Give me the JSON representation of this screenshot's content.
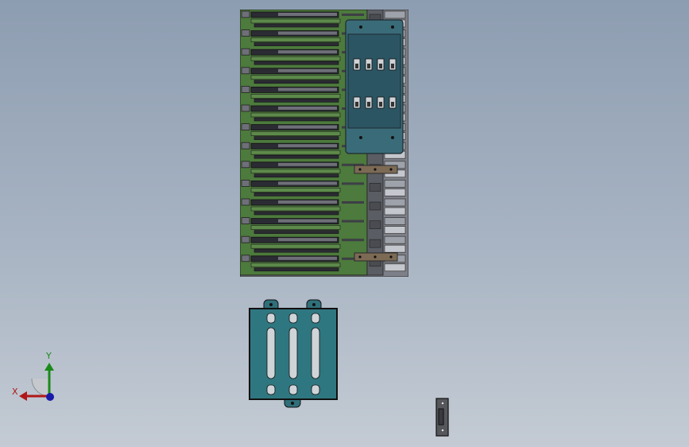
{
  "viewport": {
    "background_top": "#8d9db1",
    "background_bottom": "#c4cbd4"
  },
  "colors": {
    "pcb_green": "#4d7a3d",
    "slot_gray": "#6e6f78",
    "slot_dark": "#2b2b33",
    "teal_plate": "#2f6f7a",
    "cover_teal": "#3a6b78",
    "bracket_brown": "#7c6a55",
    "axis_y": "#1a8a1a",
    "axis_x": "#b01818",
    "axis_z": "#1a1aa8"
  },
  "parts": {
    "backplane": {
      "name": "backplane-assembly",
      "slot_count": 14
    },
    "bracket_plate": {
      "name": "mounting-bracket-plate",
      "slot_count": 3
    },
    "small_clip": {
      "name": "small-clip-part"
    }
  },
  "axis_triad": {
    "x_label": "X",
    "y_label": "Y",
    "icon": "axis-triad-icon"
  }
}
